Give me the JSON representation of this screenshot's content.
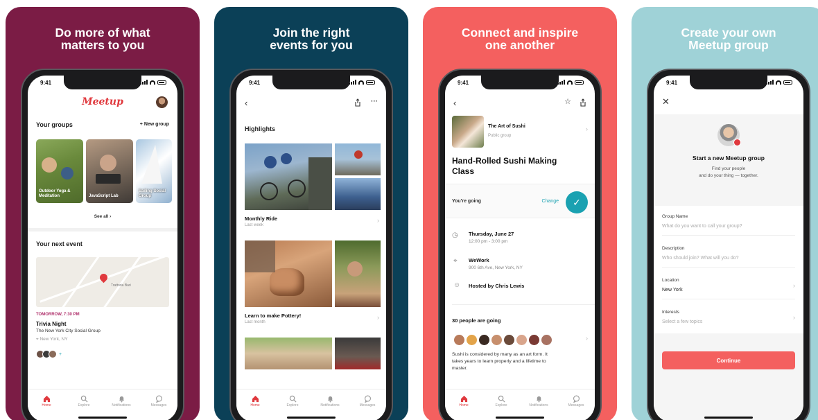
{
  "panels": [
    {
      "headline": [
        "Do more of what",
        "matters to you"
      ],
      "status_time": "9:41",
      "logo": "Meetup",
      "your_groups": "Your groups",
      "new_group": "+ New group",
      "groups": [
        "Outdoor Yoga & Meditation",
        "JavaScript Lab",
        "Sailing Social Group"
      ],
      "see_all": "See all",
      "next_event_title": "Your next event",
      "map_label": "Trattoria Bari",
      "event_time": "TOMORROW, 7:30 PM",
      "event_name": "Trivia Night",
      "event_group": "The New York City Social Group",
      "event_location": "New York, NY",
      "attendee_more": "+",
      "tabs": [
        "Home",
        "Explore",
        "Notifications",
        "Messages"
      ]
    },
    {
      "headline": [
        "Join the right",
        "events for you"
      ],
      "status_time": "9:41",
      "highlights": "Highlights",
      "item1_title": "Monthly Ride",
      "item1_sub": "Last week",
      "item2_title": "Learn to make Pottery!",
      "item2_sub": "Last month",
      "tabs": [
        "Home",
        "Explore",
        "Notifications",
        "Messages"
      ]
    },
    {
      "headline": [
        "Connect and inspire",
        "one another"
      ],
      "status_time": "9:41",
      "group_name": "The Art of Sushi",
      "group_type": "Public group",
      "event_title": [
        "Hand-Rolled Sushi Making",
        "Class"
      ],
      "going_label": "You're going",
      "change": "Change",
      "date": "Thursday, June 27",
      "time": "12:00 pm - 3:00 pm",
      "venue": "WeWork",
      "address": "900 6th Ave, New York, NY",
      "host": "Hosted by Chris Lewis",
      "attendees": "30 people are going",
      "description": [
        "Sushi is considered by many as an art form. It",
        "takes years to learn properly and a lifetime to",
        "master."
      ],
      "tabs": [
        "Home",
        "Explore",
        "Notifications",
        "Messages"
      ]
    },
    {
      "headline": [
        "Create your own",
        "Meetup group"
      ],
      "status_time": "9:41",
      "start_title": "Start a new Meetup group",
      "start_sub": [
        "Find your people",
        "and do your thing — together."
      ],
      "fields": [
        {
          "label": "Group Name",
          "placeholder": "What do you want to call your group?"
        },
        {
          "label": "Description",
          "placeholder": "Who should join? What will you do?"
        },
        {
          "label": "Location",
          "value": "New York"
        },
        {
          "label": "Interests",
          "placeholder": "Select a few topics"
        }
      ],
      "continue": "Continue"
    }
  ],
  "colors": {
    "p1": "#7b1c45",
    "p2": "#0b4057",
    "p3": "#f4605f",
    "p4": "#9fd2d7",
    "accent": "#e0393e",
    "teal": "#1aa1b1"
  }
}
